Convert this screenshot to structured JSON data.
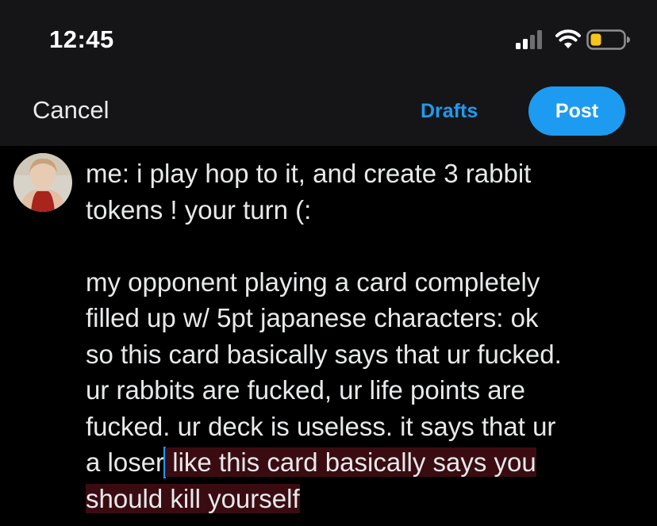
{
  "status_bar": {
    "time": "12:45",
    "icons": [
      "cellular-signal-icon",
      "wifi-icon",
      "battery-low-icon"
    ],
    "battery_color": "#f5c518"
  },
  "nav": {
    "cancel_label": "Cancel",
    "drafts_label": "Drafts",
    "post_label": "Post"
  },
  "colors": {
    "accent": "#1d9bf0",
    "background": "#000000",
    "text": "#e7e9ea",
    "selection_highlight": "#3a0c12"
  },
  "compose": {
    "lines": [
      "me: i play hop to it, and create 3 rabbit",
      "tokens ! your turn (:",
      "my opponent playing a card completely",
      "filled up w/ 5pt japanese characters: ok",
      "so this card basically says that ur fucked.",
      "ur rabbits are fucked, ur life points are",
      "fucked. ur deck is useless. it says that ur",
      "a loser",
      " like this card basically says you",
      "should kill yourself"
    ]
  }
}
